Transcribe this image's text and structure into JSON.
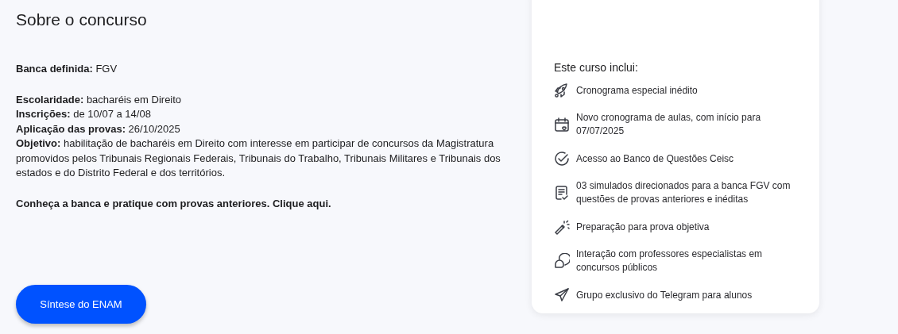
{
  "title": "Sobre o concurso",
  "details": [
    {
      "lines": [
        "**Banca definida:**  FGV"
      ]
    },
    {
      "lines": [
        "**Escolaridade:**  bacharéis em Direito",
        "**Inscrições:** de 10/07 a 14/08",
        "**Aplicação das provas:** 26/10/2025",
        "**Objetivo:**  habilitação de bacharéis em Direito com interesse em participar de concursos da Magistratura promovidos pelos Tribunais Regionais Federais, Tribunais do Trabalho, Tribunais Militares e Tribunais dos estados e do Distrito Federal e dos territórios."
      ]
    },
    {
      "lines": [
        "**Conheça a banca e pratique com provas anteriores. Clique aqui.**"
      ]
    }
  ],
  "button": "Síntese do ENAM",
  "card": {
    "heading": "Este curso inclui:",
    "items": [
      {
        "text": "Cronograma especial inédito"
      },
      {
        "text": "Novo cronograma de aulas, com início para 07/07/2025"
      },
      {
        "text": "Acesso ao Banco de Questões Ceisc"
      },
      {
        "text": "03 simulados direcionados para a banca FGV com questões de provas anteriores e inéditas"
      },
      {
        "text": "Preparação para prova objetiva"
      },
      {
        "text": "Interação com professores especialistas em concursos públicos"
      },
      {
        "text": "Grupo exclusivo do Telegram para alunos"
      }
    ]
  }
}
